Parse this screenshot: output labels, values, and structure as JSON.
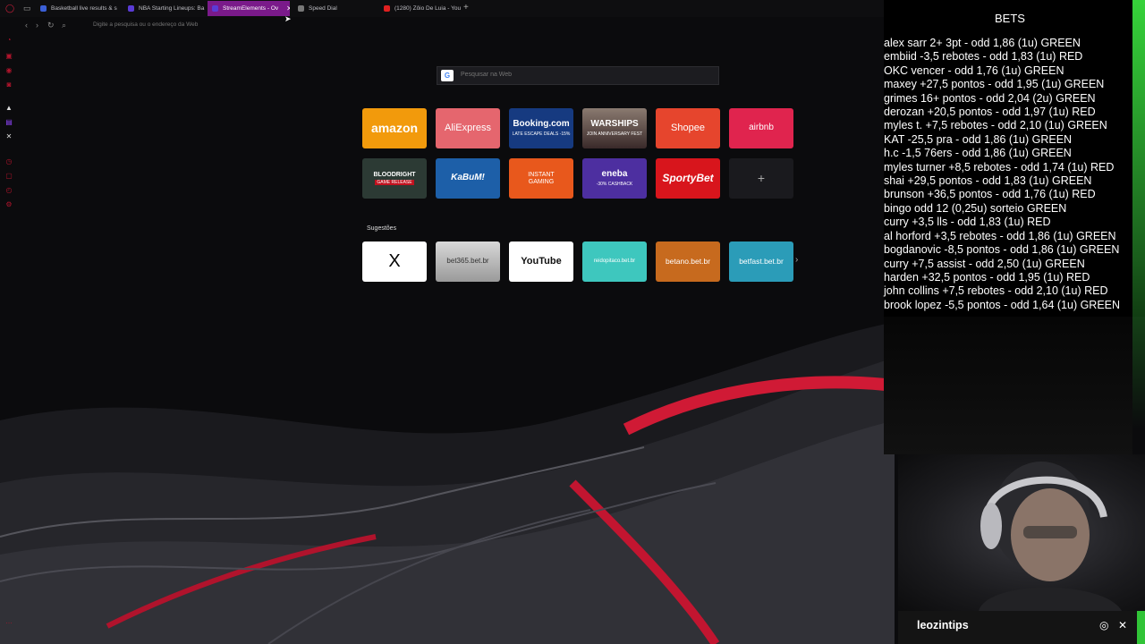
{
  "tabs": [
    {
      "label": "Basketball live results & s",
      "color": "#3b5fd6",
      "active": false
    },
    {
      "label": "NBA Starting Lineups: Ba",
      "color": "#5a3bd6",
      "active": false
    },
    {
      "label": "StreamElements - Ov",
      "color": "#5b3bd6",
      "active": true
    },
    {
      "label": "Speed Dial",
      "color": "#777777",
      "active": false
    },
    {
      "label": "(1280) Zôio De Luia - You",
      "color": "#e02020",
      "active": false
    }
  ],
  "address": {
    "placeholder": "Digite a pesquisa ou o endereço da Web"
  },
  "search": {
    "placeholder": "Pesquisar na Web",
    "engine_icon": "G"
  },
  "speed_dial": {
    "row1": [
      {
        "title": "amazon",
        "sub": "",
        "color": "#f29a0c"
      },
      {
        "title": "AliExpress",
        "sub": "",
        "color": "#e5666e"
      },
      {
        "title": "Booking.com",
        "sub": "LATE ESCAPE DEALS -15%",
        "color": "#163a80"
      },
      {
        "title": "WARSHIPS",
        "sub": "JOIN ANNIVERSARY FEST",
        "color": "#6b5a5a"
      },
      {
        "title": "Shopee",
        "sub": "",
        "color": "#e6452d"
      },
      {
        "title": "airbnb",
        "sub": "",
        "color": "#e0244e"
      }
    ],
    "row2": [
      {
        "title": "BLOODRIGHT",
        "sub": "GAME RELEASE",
        "color": "#2c3a34"
      },
      {
        "title": "KaBuM!",
        "sub": "",
        "color": "#1d5fa8"
      },
      {
        "title": "INSTANT GAMING",
        "sub": "",
        "color": "#e8581c"
      },
      {
        "title": "eneba",
        "sub": "-30% CASHBACK",
        "color": "#4d2fa0"
      },
      {
        "title": "SportyBet",
        "sub": "",
        "color": "#d8151c"
      },
      {
        "title": "+",
        "sub": "",
        "color": "#1a1a1e"
      }
    ],
    "suggestions_label": "Sugestões",
    "row3": [
      {
        "title": "X",
        "sub": "",
        "color": "#ffffff"
      },
      {
        "title": "bet365.bet.br",
        "sub": "",
        "color": "#cfcfcf"
      },
      {
        "title": "YouTube",
        "sub": "",
        "color": "#ffffff"
      },
      {
        "title": "reidopitaco.bet.br",
        "sub": "",
        "color": "#3ec7be"
      },
      {
        "title": "betano.bet.br",
        "sub": "",
        "color": "#c76a1e"
      },
      {
        "title": "betfast.bet.br",
        "sub": "",
        "color": "#2b9cb8"
      }
    ]
  },
  "bets": {
    "title": "BETS",
    "items": [
      "alex sarr 2+ 3pt - odd 1,86 (1u) GREEN",
      "embiid -3,5 rebotes - odd 1,83 (1u) RED",
      "OKC vencer - odd 1,76 (1u) GREEN",
      "maxey +27,5 pontos - odd 1,95 (1u) GREEN",
      "grimes 16+ pontos - odd 2,04 (2u) GREEN",
      "derozan +20,5 pontos - odd 1,97 (1u) RED",
      "myles t. +7,5 rebotes - odd 2,10 (1u) GREEN",
      "KAT -25,5 pra - odd 1,86 (1u) GREEN",
      "h.c -1,5 76ers - odd 1,86 (1u) GREEN",
      "myles turner +8,5 rebotes - odd 1,74 (1u) RED",
      "shai +29,5 pontos - odd 1,83 (1u) GREEN",
      "brunson +36,5 pontos - odd 1,76 (1u) RED",
      "bingo odd 12 (0,25u) sorteio GREEN",
      "curry +3,5 lls - odd 1,83 (1u) RED",
      "al horford +3,5 rebotes - odd 1,86 (1u) GREEN",
      "bogdanovic -8,5 pontos - odd 1,86 (1u) GREEN",
      "curry +7,5 assist - odd 2,50 (1u) GREEN",
      "harden +32,5 pontos - odd 1,95 (1u) RED",
      "john collins +7,5 rebotes - odd 2,10 (1u) RED",
      "brook lopez -5,5 pontos - odd 1,64 (1u) GREEN"
    ]
  },
  "streamer": {
    "name": "leozintips"
  }
}
